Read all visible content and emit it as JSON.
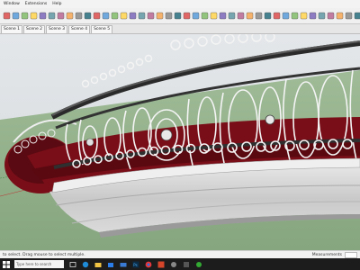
{
  "menu": [
    "Window",
    "Extensions",
    "Help"
  ],
  "toolbar_icons": [
    "select-arrow",
    "eraser",
    "pencil",
    "paint-bucket",
    "circle",
    "push-pull",
    "move",
    "rotate",
    "scale",
    "offset",
    "tape-measure",
    "protractor",
    "text",
    "axes",
    "orbit",
    "pan",
    "zoom",
    "zoom-extents",
    "walk",
    "look-around",
    "section-plane",
    "section-display",
    "iso-view",
    "top-view",
    "front-view",
    "right-view",
    "back-view",
    "left-view",
    "bottom-view",
    "xray",
    "wireframe",
    "hidden-line",
    "shaded",
    "textured",
    "monochrome",
    "warehouse",
    "extension-warehouse",
    "layout",
    "style-builder",
    "components"
  ],
  "scenes": [
    "Scene 1",
    "Scene 2",
    "Scene 3",
    "Scene 4",
    "Scene 5"
  ],
  "status": {
    "hint": "to select. Drag mouse to select multiple.",
    "measurements": "Measurements"
  },
  "taskbar": {
    "search_placeholder": "Type here to search"
  },
  "colors": {
    "toolbar_bg": "#f0f0f0",
    "sky": "#dfe3e6",
    "ground": "#8fb08a",
    "railing": "#eef0f2",
    "carpet": "#7a0e18",
    "platform": "#d2d2d2",
    "taskbar": "#1c1c1c"
  }
}
